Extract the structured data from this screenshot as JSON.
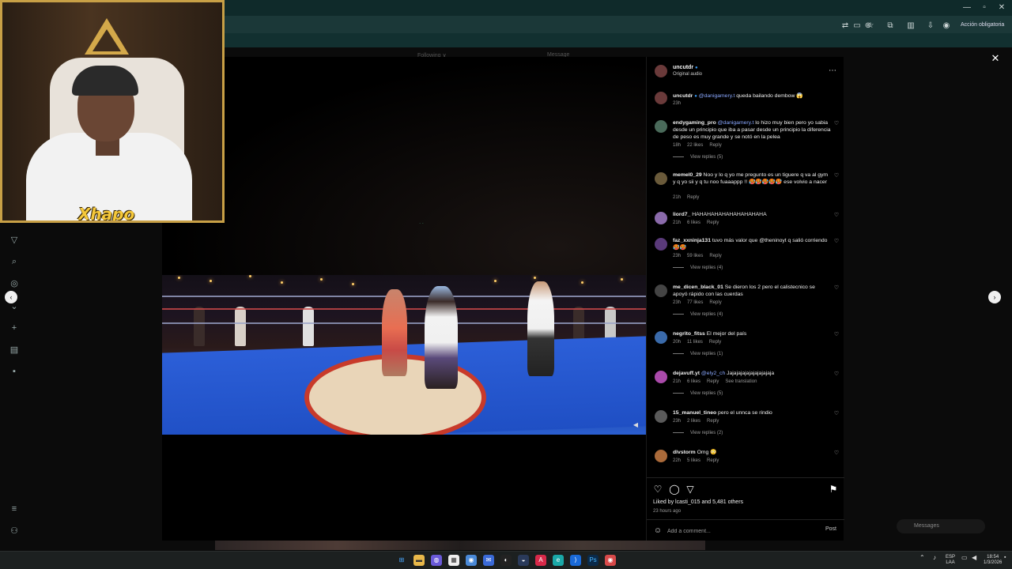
{
  "browser": {
    "action_button": "Acción obligatoria",
    "window_controls": [
      "minimize-icon",
      "maximize-icon",
      "close-icon"
    ],
    "toolbar_icons": [
      "translate-icon",
      "cast-icon",
      "install-icon",
      "star-icon",
      "extensions-icon",
      "sidebar-icon",
      "downloads-icon",
      "profile-icon"
    ]
  },
  "instagram_bg": {
    "header_left": "Following ∨",
    "header_right": "Message"
  },
  "left_rail": {
    "icons": [
      "send-icon",
      "search-icon",
      "explore-icon",
      "reels-icon",
      "create-icon",
      "analytics-icon",
      "profile-icon",
      "menu-icon",
      "threads-icon"
    ]
  },
  "post": {
    "author": "uncutdr",
    "audio": "Original audio",
    "caption_user": "uncutdr",
    "caption_mention": "@danigamery.t",
    "caption_text": "queda bailando dembow 😱",
    "caption_time": "23h",
    "liked_by": "Liked by lcasti_015 and 5,481 others",
    "time_ago": "23 hours ago",
    "comment_placeholder": "Add a comment...",
    "post_label": "Post"
  },
  "comments": [
    {
      "user": "endygaming_pro",
      "mention": "@danigamery.t",
      "text": "lo hizo muy bien pero yo sabia desde un principio que iba a pasar desde un principio la diferencia de peso es muy grande y se notó en la pelea",
      "time": "18h",
      "likes": "22 likes",
      "reply": "Reply",
      "view_replies": "View replies (5)",
      "avatar_color": "#4a6a5a"
    },
    {
      "user": "memel0_29",
      "mention": "",
      "text": "Noo y lo q yo me pregunto es un tiguere q va al gym y q yo sii y q tu noo fuaaappp !! 🥵🥵🥵🥵🥵 ese volvio a nacer",
      "time": "21h",
      "likes": "",
      "reply": "Reply",
      "view_replies": "",
      "avatar_color": "#6a5a3a"
    },
    {
      "user": "liord7_",
      "mention": "",
      "text": "HAHAHAHAHAHAHAHAHAHA",
      "time": "21h",
      "likes": "6 likes",
      "reply": "Reply",
      "view_replies": "",
      "avatar_color": "#8a6aaa"
    },
    {
      "user": "faz_xxninja131",
      "mention": "",
      "text": "tuvo más valor que @theninoyt q salió corriendo 🥵🥵",
      "time": "23h",
      "likes": "59 likes",
      "reply": "Reply",
      "view_replies": "View replies (4)",
      "avatar_color": "#5a3a7a"
    },
    {
      "user": "me_dicen_black_01",
      "mention": "",
      "text": "Se dieron los 2 pero el calistecnico se apoyó rápido con las cuerdas",
      "time": "23h",
      "likes": "77 likes",
      "reply": "Reply",
      "view_replies": "View replies (4)",
      "avatar_color": "#444444"
    },
    {
      "user": "negrito_fitss",
      "mention": "",
      "text": "El mejor del país",
      "time": "20h",
      "likes": "11 likes",
      "reply": "Reply",
      "view_replies": "View replies (1)",
      "avatar_color": "#3a6aaa"
    },
    {
      "user": "dejavuff.yt",
      "mention": "@ely2_ch",
      "text": "Jajajajajajajajajajaja",
      "time": "21h",
      "likes": "6 likes",
      "reply": "Reply",
      "extra": "See translation",
      "view_replies": "View replies (5)",
      "avatar_color": "#aa4aaa"
    },
    {
      "user": "15_manuel_tineo",
      "mention": "",
      "text": "pero el unnca se rindio",
      "time": "23h",
      "likes": "2 likes",
      "reply": "Reply",
      "view_replies": "View replies (2)",
      "avatar_color": "#5a5a5a"
    },
    {
      "user": "dlvstorm",
      "mention": "",
      "text": "Omg 😳",
      "time": "22h",
      "likes": "5 likes",
      "reply": "Reply",
      "view_replies": "",
      "avatar_color": "#aa6a3a"
    }
  ],
  "overlay_ui": {
    "messages": "Messages"
  },
  "stream": {
    "label": "Xhapo"
  },
  "taskbar": {
    "lang_top": "ESP",
    "lang_bottom": "LAA",
    "time": "18:54",
    "date": "1/3/2026"
  }
}
